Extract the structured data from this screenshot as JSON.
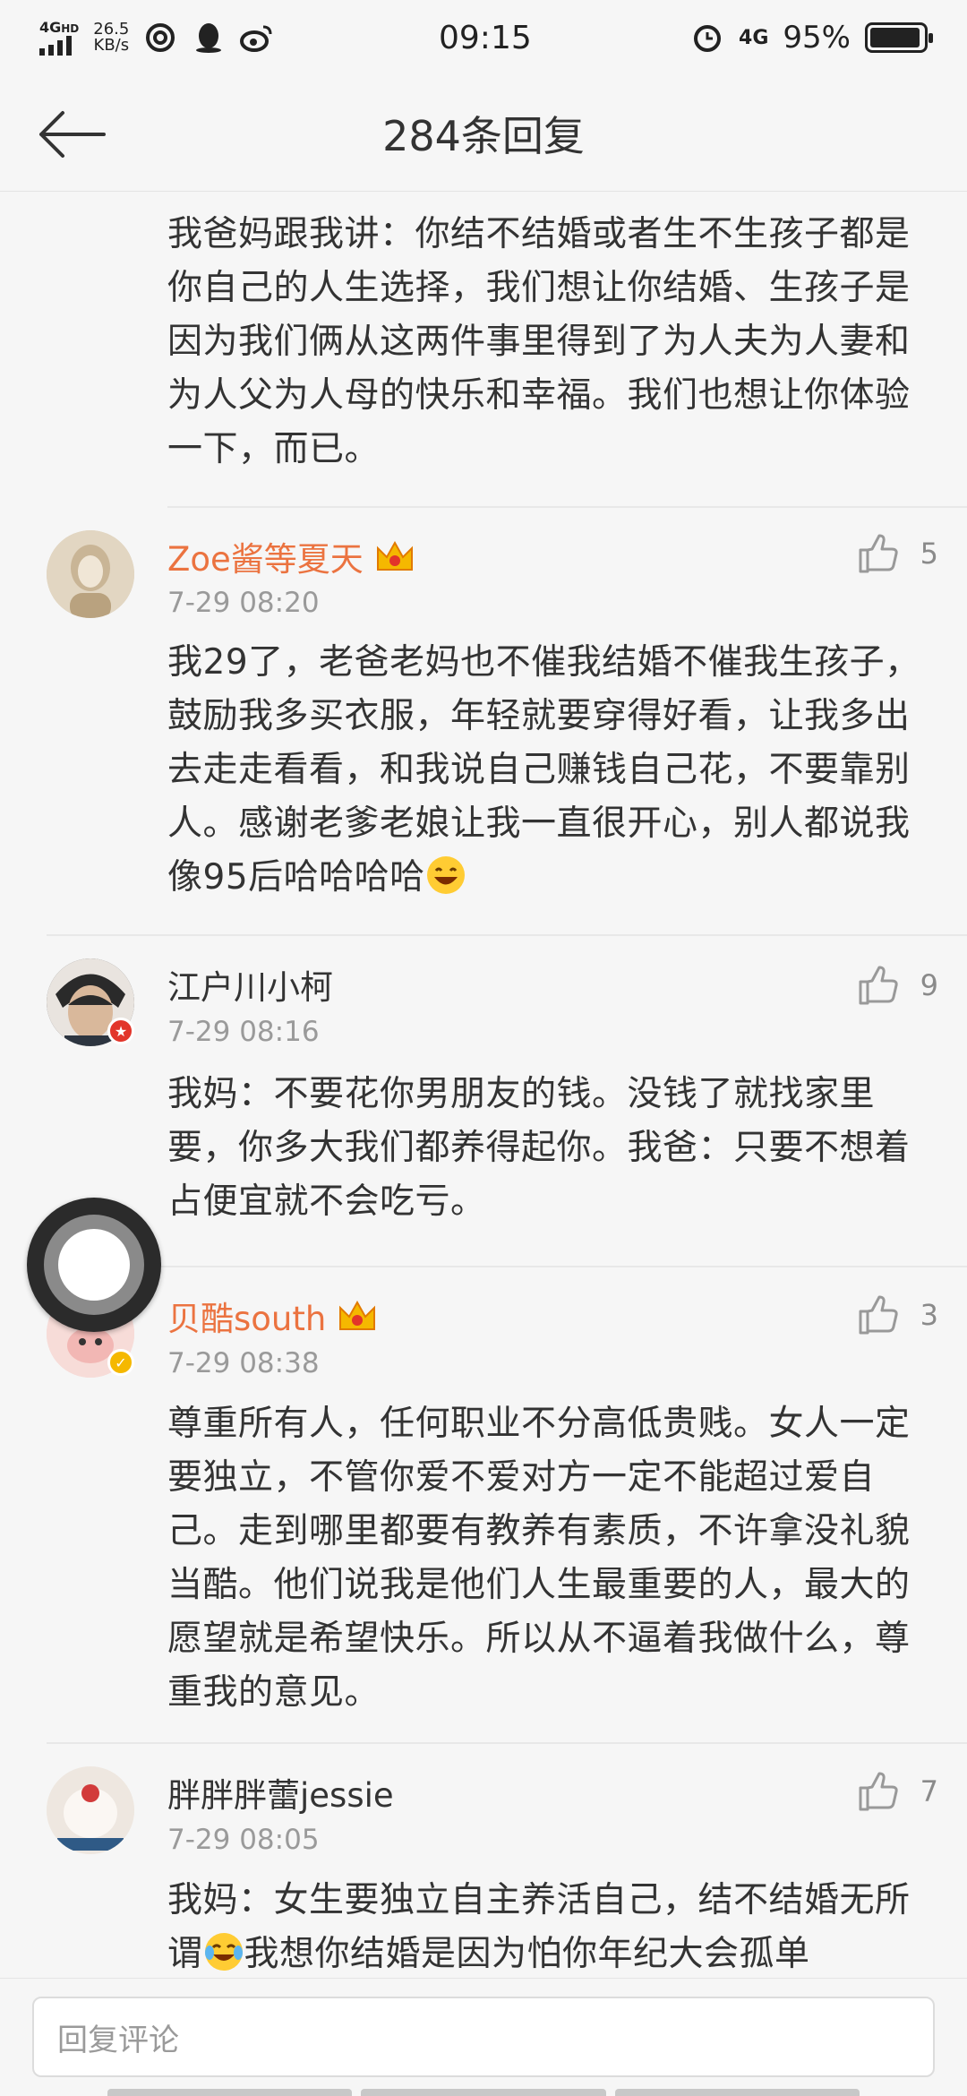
{
  "status": {
    "network": "4G",
    "network_sup": "HD",
    "speed_value": "26.5",
    "speed_unit": "KB/s",
    "time": "09:15",
    "network_right": "4G",
    "battery": "95%",
    "battery_level": 0.95
  },
  "nav": {
    "title": "284条回复"
  },
  "top_comment": {
    "text": "我爸妈跟我讲：你结不结婚或者生不生孩子都是你自己的人生选择，我们想让你结婚、生孩子是因为我们俩从这两件事里得到了为人夫为人妻和为人父为人母的快乐和幸福。我们也想让你体验一下，而已。"
  },
  "comments": [
    {
      "username": "Zoe酱等夏天",
      "time": "7-29 08:20",
      "likes": "5",
      "text": "我29了，老爸老妈也不催我结婚不催我生孩子，鼓励我多买衣服，年轻就要穿得好看，让我多出去走走看看，和我说自己赚钱自己花，不要靠别人。感谢老爹老娘让我一直很开心，别人都说我像95后哈哈哈哈",
      "vip": true
    },
    {
      "username": "江户川小柯",
      "time": "7-29 08:16",
      "likes": "9",
      "text": "我妈：不要花你男朋友的钱。没钱了就找家里要，你多大我们都养得起你。我爸：只要不想着占便宜就不会吃亏。",
      "vip": false
    },
    {
      "username": "贝酷south",
      "time": "7-29 08:38",
      "likes": "3",
      "text": "尊重所有人，任何职业不分高低贵贱。女人一定要独立，不管你爱不爱对方一定不能超过爱自己。走到哪里都要有教养有素质，不许拿没礼貌当酷。他们说我是他们人生最重要的人，最大的愿望就是希望快乐。所以从不逼着我做什么，尊重我的意见。",
      "vip": true
    },
    {
      "username": "胖胖胖蕾jessie",
      "time": "7-29 08:05",
      "likes": "7",
      "text_a": "我妈：女生要独立自主养活自己，结不结婚无所谓",
      "text_b": "我想你结婚是因为怕你年纪大会孤单",
      "vip": false
    }
  ],
  "reply_bar": {
    "placeholder": "回复评论"
  },
  "colors": {
    "vip_name": "#eb7340",
    "text": "#333333",
    "meta": "#9a9a9a"
  }
}
